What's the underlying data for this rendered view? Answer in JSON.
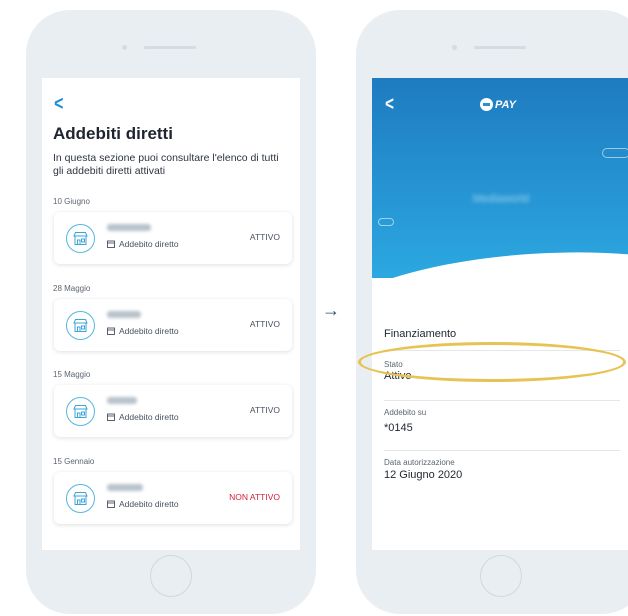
{
  "left_screen": {
    "title": "Addebiti diretti",
    "subtitle": "In questa sezione puoi consultare l'elenco di tutti gli addebiti diretti attivati",
    "groups": [
      {
        "date": "10 Giugno",
        "merchant": "Mediaworld",
        "type": "Addebito diretto",
        "status": "ATTIVO"
      },
      {
        "date": "28 Maggio",
        "merchant": "Netflix",
        "type": "Addebito diretto",
        "status": "ATTIVO"
      },
      {
        "date": "15 Maggio",
        "merchant": "Alitalia",
        "type": "Addebito diretto",
        "status": "ATTIVO"
      },
      {
        "date": "15 Gennaio",
        "merchant": "Amazon",
        "type": "Addebito diretto",
        "status": "NON ATTIVO"
      }
    ]
  },
  "right_screen": {
    "logo_text": "PAY",
    "merchant": "Mediaworld",
    "fields": [
      {
        "label": "",
        "value": "Finanziamento"
      },
      {
        "label": "Stato",
        "value": "Attivo"
      },
      {
        "label": "Addebito su",
        "value": "*0145"
      },
      {
        "label": "Data autorizzazione",
        "value": "12 Giugno 2020"
      }
    ]
  },
  "arrow_symbol": "→",
  "colors": {
    "accent": "#1a8fd6",
    "hero": "#2ca8e1",
    "inactive": "#d0213c",
    "highlight": "#e7c354"
  },
  "icons": [
    "back-chevron-icon",
    "store-icon",
    "calendar-icon",
    "pay-logo-icon"
  ]
}
